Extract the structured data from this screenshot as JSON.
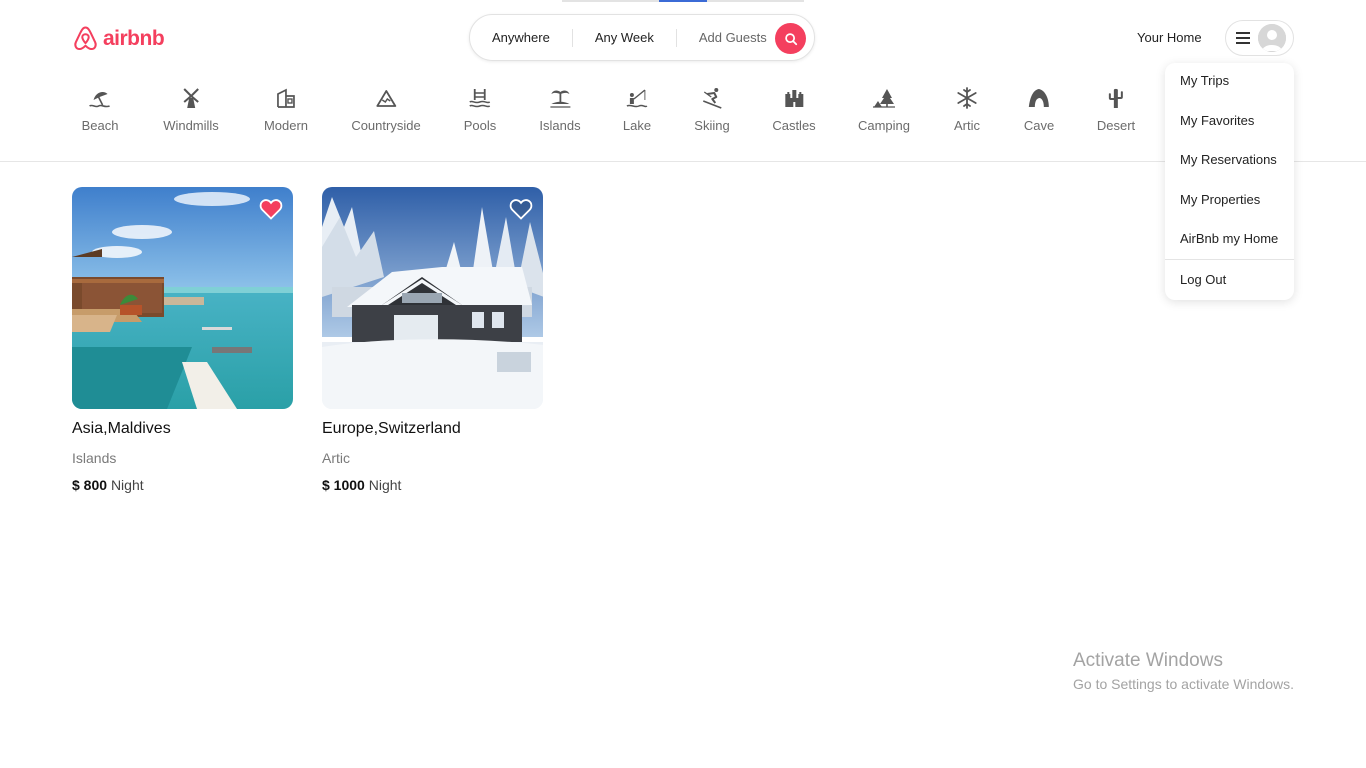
{
  "brand": {
    "name": "airbnb",
    "color": "#F43F5E"
  },
  "search": {
    "anywhere": "Anywhere",
    "any_week": "Any Week",
    "add_guests": "Add Guests",
    "button_icon": "search-icon"
  },
  "header": {
    "your_home": "Your Home",
    "menu_icon": "hamburger-icon",
    "avatar_icon": "user-avatar"
  },
  "categories": [
    {
      "label": "Beach",
      "icon": "beach-icon"
    },
    {
      "label": "Windmills",
      "icon": "windmill-icon"
    },
    {
      "label": "Modern",
      "icon": "modern-building-icon"
    },
    {
      "label": "Countryside",
      "icon": "mountain-icon"
    },
    {
      "label": "Pools",
      "icon": "pool-icon"
    },
    {
      "label": "Islands",
      "icon": "island-icon"
    },
    {
      "label": "Lake",
      "icon": "fishing-icon"
    },
    {
      "label": "Skiing",
      "icon": "skiing-icon"
    },
    {
      "label": "Castles",
      "icon": "castle-icon"
    },
    {
      "label": "Camping",
      "icon": "camping-icon"
    },
    {
      "label": "Artic",
      "icon": "snowflake-icon"
    },
    {
      "label": "Cave",
      "icon": "cave-icon"
    },
    {
      "label": "Desert",
      "icon": "cactus-icon"
    }
  ],
  "listings": [
    {
      "location": "Asia,Maldives",
      "category": "Islands",
      "price": "$ 800",
      "unit": "Night",
      "favorited": true
    },
    {
      "location": "Europe,Switzerland",
      "category": "Artic",
      "price": "$ 1000",
      "unit": "Night",
      "favorited": false
    }
  ],
  "user_menu": {
    "items": [
      "My Trips",
      "My Favorites",
      "My Reservations",
      "My Properties",
      "AirBnb my Home"
    ],
    "logout": "Log Out"
  },
  "watermark": {
    "line1": "Activate Windows",
    "line2": "Go to Settings to activate Windows."
  },
  "colors": {
    "accent": "#F43F5E",
    "muted_text": "#6B6B6B",
    "border": "#E2E2E2"
  }
}
